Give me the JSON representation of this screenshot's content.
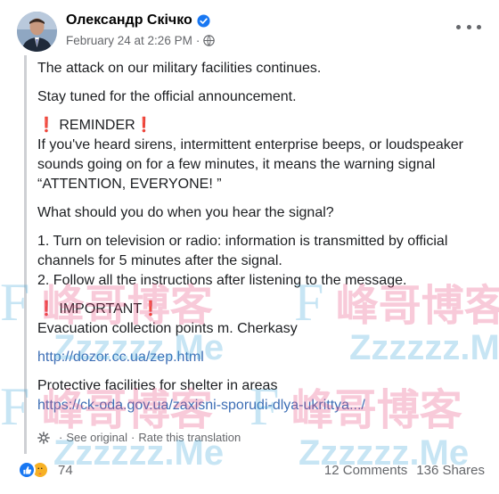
{
  "author": {
    "name": "Олександр Скічко",
    "verified": true,
    "timestamp": "February 24 at 2:26 PM",
    "privacy_icon": "globe-icon"
  },
  "post": {
    "line1": "The attack on our military facilities continues.",
    "line2": "Stay tuned for the official announcement.",
    "reminder_mark_left": "❗",
    "reminder_label": " REMINDER",
    "reminder_mark_right": "❗",
    "reminder_text": "If you've heard sirens, intermittent enterprise beeps, or loudspeaker sounds going on for a few minutes, it means the warning signal “ATTENTION, EVERYONE! ”",
    "question": "What should you do when you hear the signal?",
    "step1": "1. Turn on television or radio: information is transmitted by official channels for 5 minutes after the signal.",
    "step2": "2. Follow all the instructions after listening to the message.",
    "important_mark_left": "❗",
    "important_label": " IMPORTANT",
    "important_mark_right": "❗",
    "evacuation_text": "Evacuation collection points m. Cherkasy",
    "evacuation_link": "http://dozor.cc.ua/zep.html",
    "shelter_text": "Protective facilities for shelter in areas",
    "shelter_link": "https://ck-oda.gov.ua/zaxisni-sporudi-dlya-ukrittya.../"
  },
  "translation": {
    "see_original": "See original",
    "separator": "·",
    "rate": "Rate this translation"
  },
  "footer": {
    "reaction_count": "74",
    "comments": "12 Comments",
    "shares": "136 Shares"
  },
  "watermark": {
    "letter": "F",
    "chinese": "峰哥博客",
    "domain": "Zzzzzz.Me"
  },
  "colors": {
    "link": "#3d6eb5",
    "like": "#1877f2",
    "verified": "#1877f2",
    "secondary_text": "#65676b"
  }
}
